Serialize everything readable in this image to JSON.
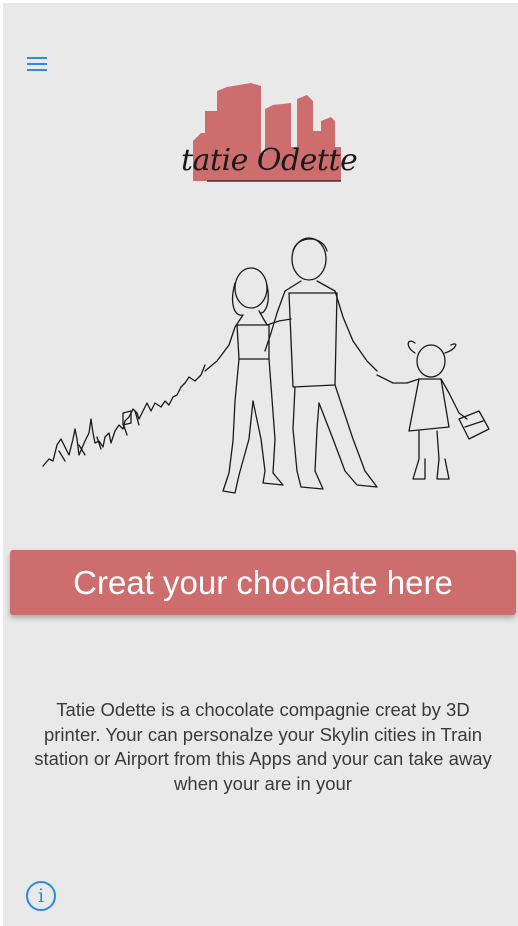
{
  "header": {
    "menu_icon": "hamburger-menu-icon",
    "accent_color": "#2d8ae6"
  },
  "logo": {
    "text": "tatie Odette",
    "brand_color": "#cd6d6d"
  },
  "hero": {
    "illustration": "family-skyline-illustration"
  },
  "cta": {
    "label": "Creat your chocolate here",
    "color": "#cd6d6d"
  },
  "description": {
    "text": "Tatie Odette is a chocolate compagnie creat by 3D printer. Your can personalze your Skylin cities in Train station or Airport from this Apps and your can take away when your are in your"
  },
  "footer": {
    "info_icon": "info-icon",
    "info_glyph": "i"
  }
}
